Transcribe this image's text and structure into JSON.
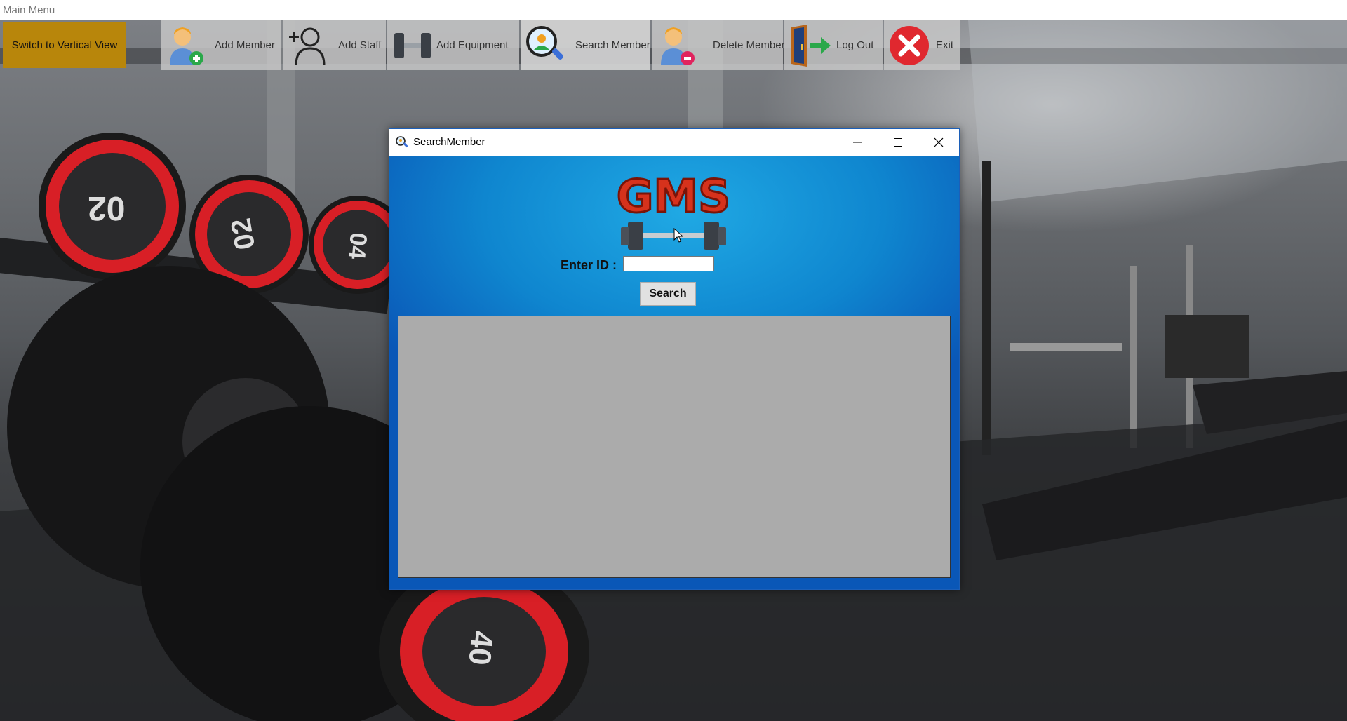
{
  "window": {
    "title": "Main Menu"
  },
  "toolbar": {
    "switch_label": "Switch to Vertical View",
    "buttons": [
      {
        "label": "Add Member",
        "icon": "add-member-icon"
      },
      {
        "label": "Add Staff",
        "icon": "add-staff-icon"
      },
      {
        "label": "Add Equipment",
        "icon": "dumbbell-icon"
      },
      {
        "label": "Search Member",
        "icon": "search-member-icon"
      },
      {
        "label": "Delete Member",
        "icon": "delete-member-icon"
      },
      {
        "label": "Log Out",
        "icon": "logout-door-icon"
      },
      {
        "label": "Exit",
        "icon": "exit-icon"
      }
    ]
  },
  "background": {
    "plate_labels": [
      "02",
      "02",
      "04",
      "40"
    ]
  },
  "dialog": {
    "title": "SearchMember",
    "logo_text": "GMS",
    "id_label": "Enter ID :",
    "id_value": "",
    "search_label": "Search"
  },
  "colors": {
    "switch_button": "#b8860b",
    "dialog_gradient_top": "#20a9e4",
    "dialog_gradient_bottom": "#0a57b7",
    "logo_red": "#d6321c",
    "result_grid": "#ababab"
  }
}
